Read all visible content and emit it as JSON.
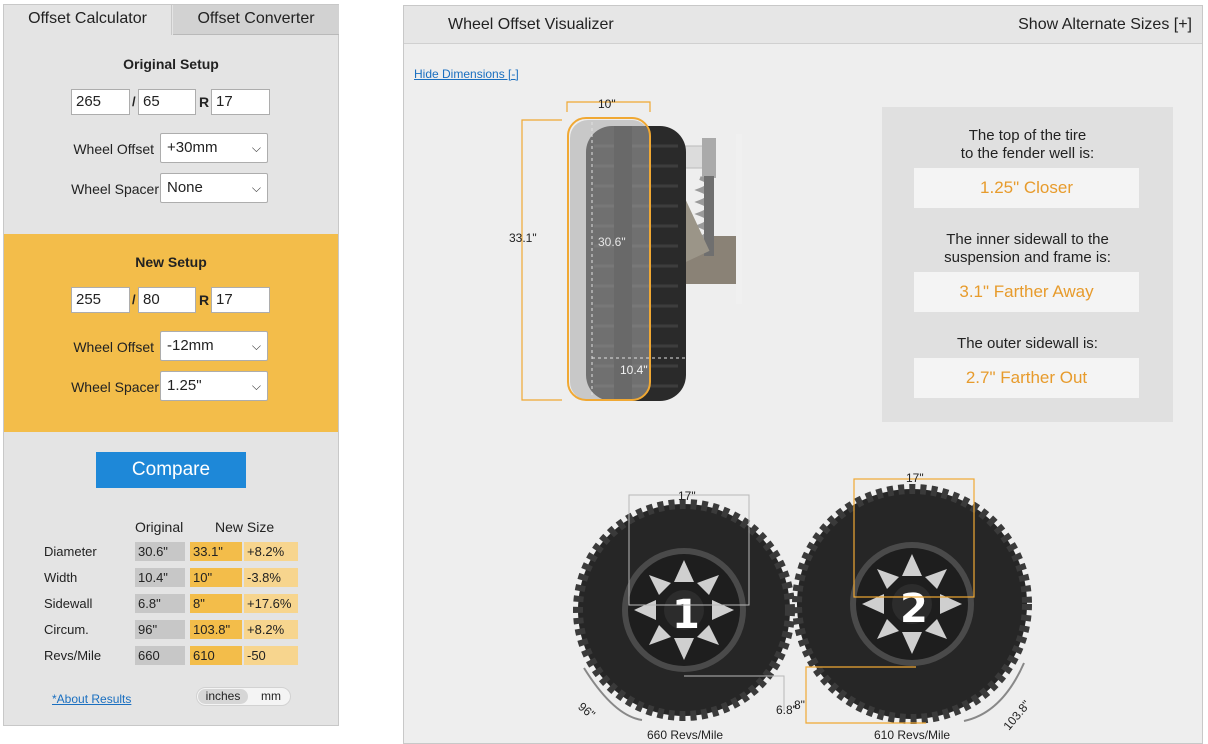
{
  "tabs": {
    "calculator": "Offset Calculator",
    "converter": "Offset Converter"
  },
  "original": {
    "title": "Original Setup",
    "width": "265",
    "aspect": "65",
    "rim": "17",
    "slash": "/",
    "r": "R",
    "offset_label": "Wheel Offset",
    "offset_value": "+30mm",
    "spacer_label": "Wheel Spacer",
    "spacer_value": "None"
  },
  "new": {
    "title": "New Setup",
    "width": "255",
    "aspect": "80",
    "rim": "17",
    "slash": "/",
    "r": "R",
    "offset_label": "Wheel Offset",
    "offset_value": "-12mm",
    "spacer_label": "Wheel Spacer",
    "spacer_value": "1.25\""
  },
  "compare_label": "Compare",
  "results": {
    "col_original": "Original",
    "col_new": "New Size",
    "rows": [
      {
        "label": "Diameter",
        "orig": "30.6\"",
        "new": "33.1\"",
        "diff": "+8.2%"
      },
      {
        "label": "Width",
        "orig": "10.4\"",
        "new": "10\"",
        "diff": "-3.8%"
      },
      {
        "label": "Sidewall",
        "orig": "6.8\"",
        "new": "8\"",
        "diff": "+17.6%"
      },
      {
        "label": "Circum.",
        "orig": "96\"",
        "new": "103.8\"",
        "diff": "+8.2%"
      },
      {
        "label": "Revs/Mile",
        "orig": "660",
        "new": "610",
        "diff": "-50"
      }
    ],
    "about_link": "*About Results",
    "unit_inches": "inches",
    "unit_mm": "mm"
  },
  "visualizer": {
    "title": "Wheel Offset Visualizer",
    "alt_sizes": "Show Alternate Sizes [+]",
    "hide_dims": "Hide Dimensions [-]",
    "side": {
      "top_width": "10\"",
      "left_height": "33.1\"",
      "inner_height": "30.6\"",
      "bottom_width": "10.4\""
    },
    "info": [
      {
        "q1": "The top of the tire",
        "q2": "to the fender well is:",
        "a": "1.25\" Closer"
      },
      {
        "q1": "The inner sidewall to the",
        "q2": "suspension and frame is:",
        "a": "3.1\" Farther Away"
      },
      {
        "q1": "The outer sidewall is:",
        "q2": "",
        "a": "2.7\" Farther Out"
      }
    ],
    "wheel1": {
      "number": "1",
      "rim": "17\"",
      "circ": "96\"",
      "sidewall": "6.8\"",
      "revs": "660 Revs/Mile"
    },
    "wheel2": {
      "number": "2",
      "rim": "17\"",
      "circ": "103.8\"",
      "sidewall": "8\"",
      "revs": "610 Revs/Mile"
    },
    "colors": {
      "accent": "#f3bd4a",
      "orange_text": "#e79b2c",
      "button": "#1e88d8"
    }
  }
}
